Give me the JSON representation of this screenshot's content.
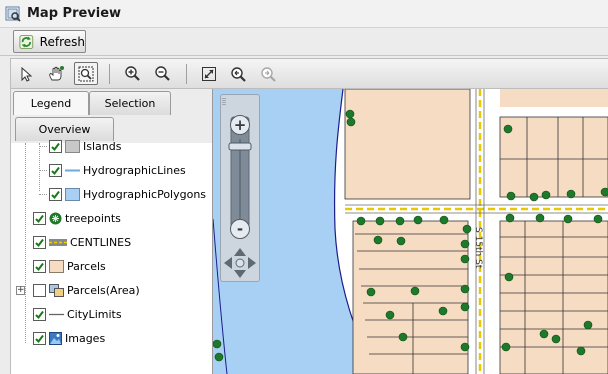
{
  "window": {
    "title": "Map Preview",
    "icon": "map-preview-icon"
  },
  "toolbar": {
    "refresh_label": "Refresh",
    "tools": [
      {
        "name": "select-arrow-icon",
        "active": false
      },
      {
        "name": "pan-hand-icon",
        "active": false
      },
      {
        "name": "zoom-window-icon",
        "active": true
      },
      {
        "name": "zoom-in-icon",
        "active": false
      },
      {
        "name": "zoom-out-icon",
        "active": false
      },
      {
        "name": "full-extent-icon",
        "active": false
      },
      {
        "name": "previous-extent-icon",
        "active": false
      },
      {
        "name": "next-extent-icon",
        "active": false,
        "disabled": true
      }
    ]
  },
  "tabs": {
    "legend": "Legend",
    "selection": "Selection",
    "overview": "Overview"
  },
  "layers": [
    {
      "label": "Islands",
      "checked": true,
      "symbol": "gray-box"
    },
    {
      "label": "HydrographicLines",
      "checked": true,
      "symbol": "blue-line"
    },
    {
      "label": "HydrographicPolygons",
      "checked": true,
      "symbol": "blue-box"
    },
    {
      "label": "treepoints",
      "checked": true,
      "symbol": "tree"
    },
    {
      "label": "CENTLINES",
      "checked": true,
      "symbol": "dashed-road"
    },
    {
      "label": "Parcels",
      "checked": true,
      "symbol": "tan-box"
    },
    {
      "label": "Parcels(Area)",
      "checked": false,
      "symbol": "multi-box",
      "expandable": true
    },
    {
      "label": "CityLimits",
      "checked": true,
      "symbol": "gray-line"
    },
    {
      "label": "Images",
      "checked": true,
      "symbol": "image"
    }
  ],
  "map": {
    "street_label": "S 15th St",
    "colors": {
      "water": "#a8d0f4",
      "parcel": "#f7dcc4",
      "road": "#ffffff",
      "tree": "#1e7a2a",
      "centerline": "#e8c800"
    }
  },
  "navigation": {
    "zoom_in": "+",
    "zoom_out": "-"
  }
}
